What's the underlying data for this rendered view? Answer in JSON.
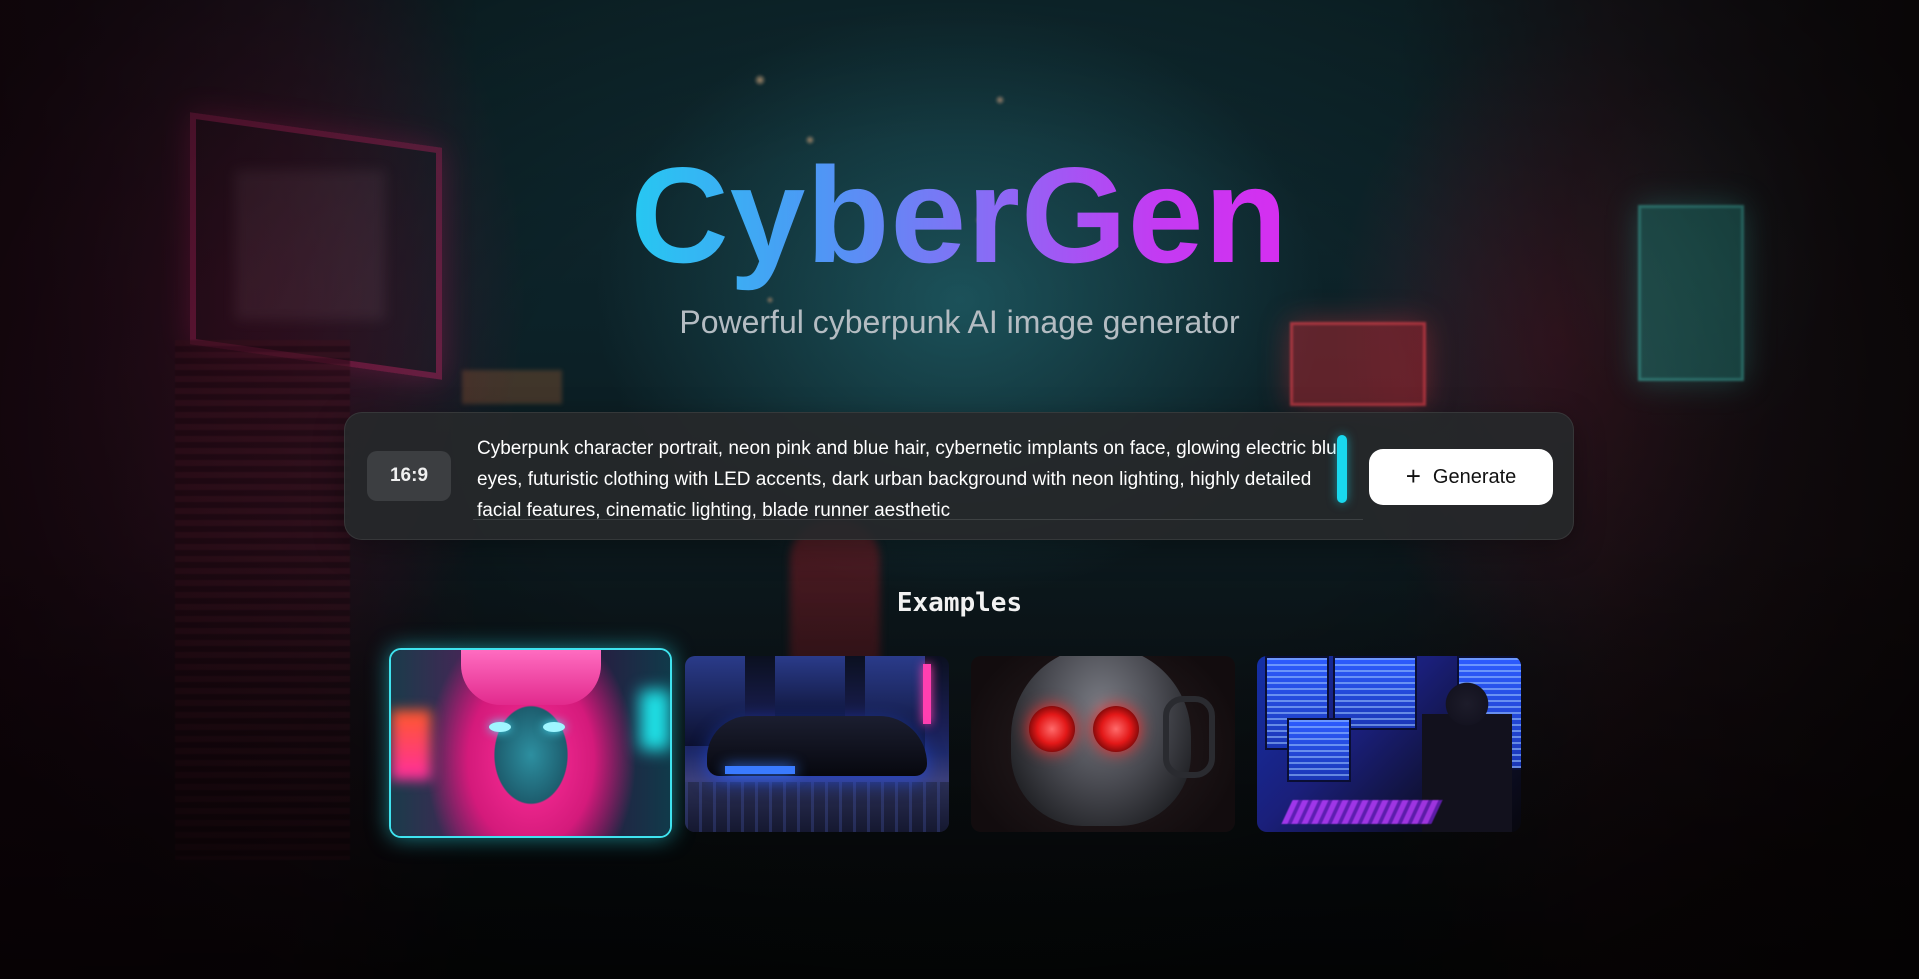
{
  "app": {
    "title": "CyberGen",
    "subtitle": "Powerful cyberpunk AI image generator"
  },
  "prompt_bar": {
    "aspect_ratio": "16:9",
    "prompt": "Cyberpunk character portrait, neon pink and blue hair, cybernetic implants on face, glowing electric blue eyes, futuristic clothing with LED accents, dark urban background with neon lighting, highly detailed facial features, cinematic lighting, blade runner aesthetic",
    "generate_label": "Generate",
    "generate_icon": "plus-icon"
  },
  "examples": {
    "heading": "Examples",
    "items": [
      {
        "subject": "neon portrait",
        "selected": true
      },
      {
        "subject": "flying car",
        "selected": false
      },
      {
        "subject": "red-eyed robot",
        "selected": false
      },
      {
        "subject": "hacker at screens",
        "selected": false
      }
    ]
  },
  "colors": {
    "title_gradient": [
      "#26c8f2",
      "#8a6bf5",
      "#d62ef0"
    ],
    "accent_cyan": "#19d8ee",
    "panel_bg": "#26282a"
  }
}
